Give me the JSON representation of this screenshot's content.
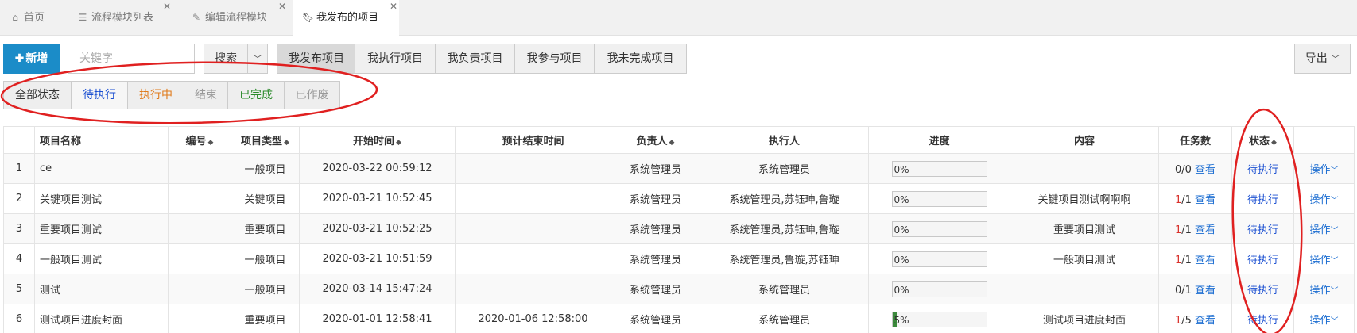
{
  "tabs": [
    {
      "label": "首页",
      "icon": "home-icon",
      "closable": false,
      "active": false
    },
    {
      "label": "流程模块列表",
      "icon": "list-icon",
      "closable": true,
      "active": false
    },
    {
      "label": "编辑流程模块",
      "icon": "edit-icon",
      "closable": true,
      "active": false
    },
    {
      "label": "我发布的项目",
      "icon": "bookmark-icon",
      "closable": true,
      "active": true
    }
  ],
  "toolbar": {
    "add_label": "新增",
    "search_placeholder": "关键字",
    "search_label": "搜索",
    "scope_buttons": [
      "我发布项目",
      "我执行项目",
      "我负责项目",
      "我参与项目",
      "我未完成项目"
    ],
    "selected_scope": "我发布项目",
    "export_label": "导出"
  },
  "status_filter": {
    "items": [
      {
        "label": "全部状态",
        "color": "#333333"
      },
      {
        "label": "待执行",
        "color": "#1a4fd1"
      },
      {
        "label": "执行中",
        "color": "#e07a1a"
      },
      {
        "label": "结束",
        "color": "#999999"
      },
      {
        "label": "已完成",
        "color": "#2a8a2a"
      },
      {
        "label": "已作废",
        "color": "#999999"
      }
    ]
  },
  "table": {
    "columns": [
      {
        "label": "",
        "sortable": false
      },
      {
        "label": "项目名称",
        "sortable": false
      },
      {
        "label": "编号",
        "sortable": true
      },
      {
        "label": "项目类型",
        "sortable": true
      },
      {
        "label": "开始时间",
        "sortable": true
      },
      {
        "label": "预计结束时间",
        "sortable": false
      },
      {
        "label": "负责人",
        "sortable": true
      },
      {
        "label": "执行人",
        "sortable": false
      },
      {
        "label": "进度",
        "sortable": false
      },
      {
        "label": "内容",
        "sortable": false
      },
      {
        "label": "任务数",
        "sortable": false
      },
      {
        "label": "状态",
        "sortable": true
      },
      {
        "label": "",
        "sortable": false
      }
    ],
    "rows": [
      {
        "no": "1",
        "name": "ce",
        "code": "",
        "type": "一般项目",
        "start": "2020-03-22 00:59:12",
        "end": "",
        "owner": "系统管理员",
        "executors": "系统管理员",
        "progress": 0,
        "progress_text": "0%",
        "content": "",
        "tasks_done": "0",
        "tasks_total": "/0",
        "view": "查看",
        "status": "待执行",
        "action": "操作"
      },
      {
        "no": "2",
        "name": "关键项目测试",
        "code": "",
        "type": "关键项目",
        "start": "2020-03-21 10:52:45",
        "end": "",
        "owner": "系统管理员",
        "executors": "系统管理员,苏钰珅,鲁璇",
        "progress": 0,
        "progress_text": "0%",
        "content": "关键项目测试啊啊啊",
        "tasks_done": "1",
        "tasks_total": "/1",
        "view": "查看",
        "status": "待执行",
        "action": "操作"
      },
      {
        "no": "3",
        "name": "重要项目测试",
        "code": "",
        "type": "重要项目",
        "start": "2020-03-21 10:52:25",
        "end": "",
        "owner": "系统管理员",
        "executors": "系统管理员,苏钰珅,鲁璇",
        "progress": 0,
        "progress_text": "0%",
        "content": "重要项目测试",
        "tasks_done": "1",
        "tasks_total": "/1",
        "view": "查看",
        "status": "待执行",
        "action": "操作"
      },
      {
        "no": "4",
        "name": "一般项目测试",
        "code": "",
        "type": "一般项目",
        "start": "2020-03-21 10:51:59",
        "end": "",
        "owner": "系统管理员",
        "executors": "系统管理员,鲁璇,苏钰珅",
        "progress": 0,
        "progress_text": "0%",
        "content": "一般项目测试",
        "tasks_done": "1",
        "tasks_total": "/1",
        "view": "查看",
        "status": "待执行",
        "action": "操作"
      },
      {
        "no": "5",
        "name": "测试",
        "code": "",
        "type": "一般项目",
        "start": "2020-03-14 15:47:24",
        "end": "",
        "owner": "系统管理员",
        "executors": "系统管理员",
        "progress": 0,
        "progress_text": "0%",
        "content": "",
        "tasks_done": "0",
        "tasks_total": "/1",
        "view": "查看",
        "status": "待执行",
        "action": "操作"
      },
      {
        "no": "6",
        "name": "测试项目进度封面",
        "code": "",
        "type": "重要项目",
        "start": "2020-01-01 12:58:41",
        "end": "2020-01-06 12:58:00",
        "owner": "系统管理员",
        "executors": "系统管理员",
        "progress": 5,
        "progress_text": "5%",
        "content": "测试项目进度封面",
        "tasks_done": "1",
        "tasks_total": "/5",
        "view": "查看",
        "status": "待执行",
        "action": "操作"
      }
    ]
  },
  "colors": {
    "brand": "#1b8cc8",
    "annotation": "#e02020",
    "status_pending": "#1a4fd1"
  }
}
